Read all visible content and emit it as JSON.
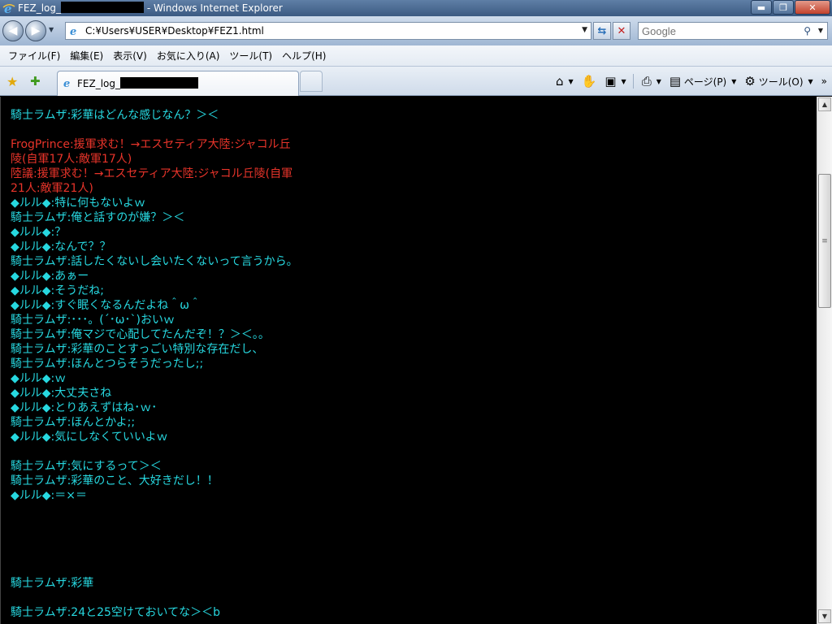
{
  "window": {
    "title_prefix": "FEZ_log_",
    "title_suffix": " - Windows Internet Explorer",
    "minimize": "▬",
    "maximize": "❐",
    "close": "✕"
  },
  "address_bar": {
    "url": "C:¥Users¥USER¥Desktop¥FEZ1.html",
    "search_placeholder": "Google"
  },
  "menu": [
    "ファイル(F)",
    "編集(E)",
    "表示(V)",
    "お気に入り(A)",
    "ツール(T)",
    "ヘルプ(H)"
  ],
  "tab": {
    "title": "FEZ_log_"
  },
  "commands": {
    "page_label": "ページ(P)",
    "tools_label": "ツール(O)"
  },
  "colors": {
    "chat_cyan": "#27d8e0",
    "chat_red": "#e8342a",
    "background": "#000000"
  },
  "log": [
    {
      "text": "騎士ラムザ:彩華はどんな感じなん？＞＜",
      "color": "cyan"
    },
    {
      "text": "",
      "color": "cyan"
    },
    {
      "text": "FrogPrince:援軍求む！→エスセティア大陸:ジャコル丘",
      "color": "red"
    },
    {
      "text": "陵(自軍17人:敵軍17人)",
      "color": "red"
    },
    {
      "text": "陸議:援軍求む！→エスセティア大陸:ジャコル丘陵(自軍",
      "color": "red"
    },
    {
      "text": "21人:敵軍21人)",
      "color": "red"
    },
    {
      "text": "◆ルル◆:特に何もないよｗ",
      "color": "cyan"
    },
    {
      "text": "騎士ラムザ:俺と話すのが嫌？＞＜",
      "color": "cyan"
    },
    {
      "text": "◆ルル◆:？",
      "color": "cyan"
    },
    {
      "text": "◆ルル◆:なんで？？",
      "color": "cyan"
    },
    {
      "text": "騎士ラムザ:話したくないし会いたくないって言うから。",
      "color": "cyan"
    },
    {
      "text": "◆ルル◆:あぁー",
      "color": "cyan"
    },
    {
      "text": "◆ルル◆:そうだね;",
      "color": "cyan"
    },
    {
      "text": "◆ルル◆:すぐ眠くなるんだよね＾ω＾",
      "color": "cyan"
    },
    {
      "text": "騎士ラムザ:･･･。(´･ω･`)おいｗ",
      "color": "cyan"
    },
    {
      "text": "騎士ラムザ:俺マジで心配してたんだぞ！？＞＜。。",
      "color": "cyan"
    },
    {
      "text": "騎士ラムザ:彩華のことすっごい特別な存在だし、",
      "color": "cyan"
    },
    {
      "text": "騎士ラムザ:ほんとつらそうだったし;;",
      "color": "cyan"
    },
    {
      "text": "◆ルル◆:ｗ",
      "color": "cyan"
    },
    {
      "text": "◆ルル◆:大丈夫さね",
      "color": "cyan"
    },
    {
      "text": "◆ルル◆:とりあえずはね･ｗ･",
      "color": "cyan"
    },
    {
      "text": "騎士ラムザ:ほんとかよ;;",
      "color": "cyan"
    },
    {
      "text": "◆ルル◆:気にしなくていいよｗ",
      "color": "cyan"
    },
    {
      "text": "",
      "color": "cyan"
    },
    {
      "text": "騎士ラムザ:気にするって＞＜",
      "color": "cyan"
    },
    {
      "text": "騎士ラムザ:彩華のこと、大好きだし！！",
      "color": "cyan"
    },
    {
      "text": "◆ルル◆:＝×＝",
      "color": "cyan"
    },
    {
      "text": "",
      "color": "cyan"
    },
    {
      "text": "",
      "color": "cyan"
    },
    {
      "text": "",
      "color": "cyan"
    },
    {
      "text": "",
      "color": "cyan"
    },
    {
      "text": "",
      "color": "cyan"
    },
    {
      "text": "騎士ラムザ:彩華",
      "color": "cyan"
    },
    {
      "text": "",
      "color": "cyan"
    },
    {
      "text": "騎士ラムザ:24と25空けておいてな＞＜b",
      "color": "cyan"
    }
  ]
}
